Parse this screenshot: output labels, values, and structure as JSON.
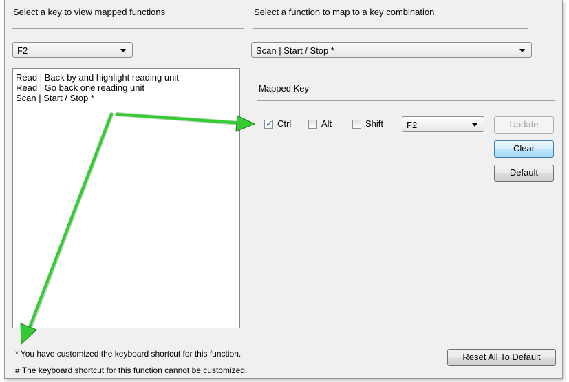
{
  "left_panel": {
    "header": "Select a key to view mapped functions",
    "key_select_value": "F2",
    "mapped_functions": [
      "Read | Back by and highlight reading unit",
      "Read | Go back one reading unit",
      "Scan | Start / Stop *"
    ]
  },
  "right_panel": {
    "header": "Select a function to map to a key combination",
    "function_select_value": "Scan | Start / Stop *",
    "mapped_key_label": "Mapped Key",
    "modifiers": {
      "ctrl": {
        "label": "Ctrl",
        "checked": true
      },
      "alt": {
        "label": "Alt",
        "checked": false
      },
      "shift": {
        "label": "Shift",
        "checked": false
      }
    },
    "key_value": "F2",
    "buttons": {
      "update": "Update",
      "clear": "Clear",
      "default": "Default"
    }
  },
  "footer": {
    "note_customized": "* You have customized the keyboard shortcut for this function.",
    "note_locked": "# The keyboard shortcut for this function cannot be customized.",
    "reset_all": "Reset All To Default"
  },
  "colors": {
    "annotation_arrow": "#33cc33",
    "checkmark": "#2a55b5",
    "panel_background": "#f0f0f0"
  }
}
